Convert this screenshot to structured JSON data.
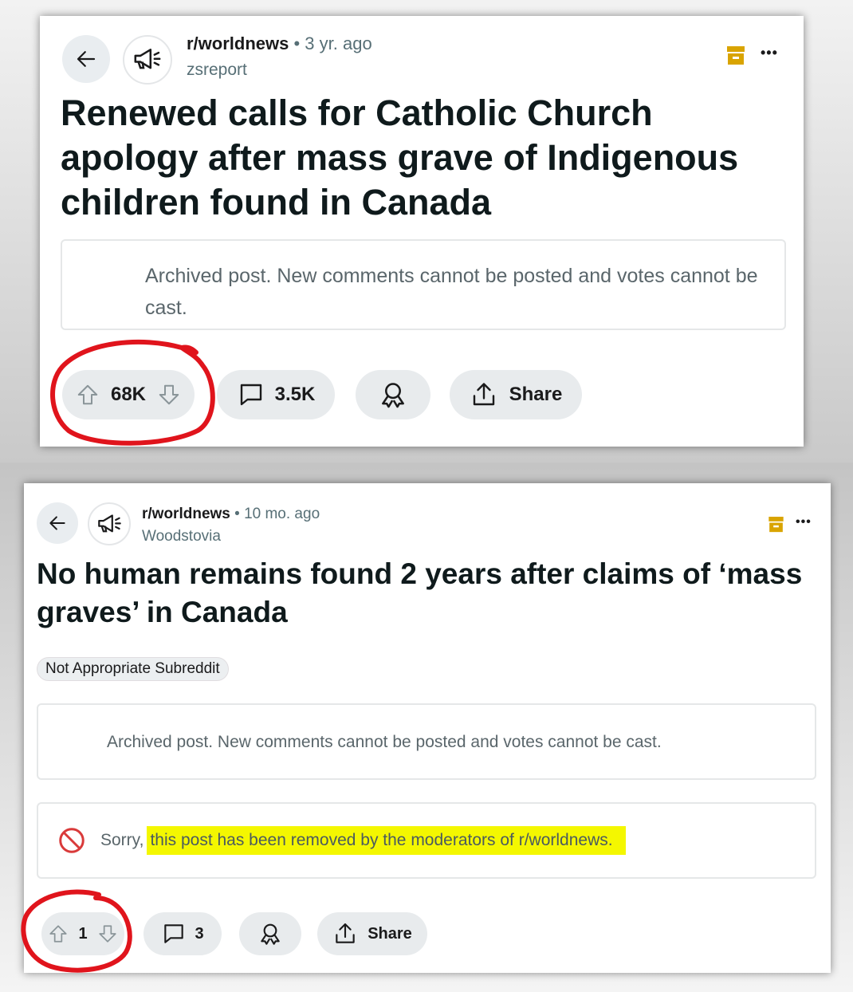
{
  "post1": {
    "subreddit": "r/worldnews",
    "time": "• 3 yr. ago",
    "author": "zsreport",
    "title": "Renewed calls for Catholic Church apology after mass grave of Indigenous children found in Canada",
    "more_label": "•••",
    "archived_notice": "Archived post. New comments cannot be posted and votes cannot be cast.",
    "votes": "68K",
    "comments": "3.5K",
    "share_label": "Share"
  },
  "post2": {
    "subreddit": "r/worldnews",
    "time": "• 10 mo. ago",
    "author": "Woodstovia",
    "title": "No human remains found 2 years after claims of ‘mass graves’ in Canada",
    "more_label": "•••",
    "flair": "Not Appropriate Subreddit",
    "archived_notice": "Archived post. New comments cannot be posted and votes cannot be cast.",
    "removed_prefix": "Sorry,",
    "removed_highlight": "this post has been removed by the moderators of r/worldnews.",
    "votes": "1",
    "comments": "3",
    "share_label": "Share"
  },
  "colors": {
    "archive_icon": "#d9a400",
    "annotation_red": "#e0141c",
    "highlight": "#f4f700",
    "pill_bg": "#e8ebed"
  },
  "icons": [
    "back-arrow-icon",
    "megaphone-icon",
    "archive-icon",
    "more-icon",
    "upvote-icon",
    "downvote-icon",
    "comment-icon",
    "award-icon",
    "share-icon",
    "blocked-icon"
  ]
}
